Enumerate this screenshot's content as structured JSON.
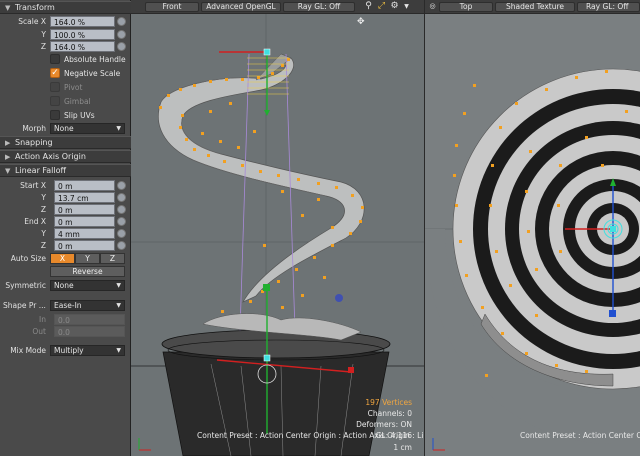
{
  "panel": {
    "transform": {
      "title": "Transform",
      "scale_label": "Scale X",
      "y_label": "Y",
      "z_label": "Z",
      "scale_x": "164.0 %",
      "scale_y": "100.0 %",
      "scale_z": "164.0 %",
      "absolute_handle": "Absolute Handle",
      "negative_scale": "Negative Scale",
      "pivot": "Pivot",
      "gimbal": "Gimbal",
      "slip_uvs": "Slip UVs",
      "morph_label": "Morph",
      "morph_value": "None"
    },
    "snapping": "Snapping",
    "action_axis_origin": "Action Axis Origin",
    "linear_falloff": {
      "title": "Linear Falloff",
      "start_label": "Start X",
      "start_x": "0 m",
      "start_y": "13.7 cm",
      "start_z": "0 m",
      "end_label": "End X",
      "end_x": "0 m",
      "end_y": "4 mm",
      "end_z": "0 m",
      "y_label": "Y",
      "z_label": "Z",
      "auto_size_label": "Auto Size",
      "auto_size_x": "X",
      "auto_size_y": "Y",
      "auto_size_z": "Z",
      "reverse": "Reverse",
      "symmetric_label": "Symmetric",
      "symmetric_value": "None",
      "shape_preset_label": "Shape Pr ...",
      "shape_preset_value": "Ease-In",
      "in_label": "In",
      "in_value": "0.0",
      "out_label": "Out",
      "out_value": "0.0",
      "mix_mode_label": "Mix Mode",
      "mix_mode_value": "Multiply"
    }
  },
  "viewport_left": {
    "view": "Front",
    "shading": "Advanced OpenGL",
    "raygl": "Ray GL: Off",
    "icons": [
      "search-icon",
      "fit-icon",
      "gear-icon",
      "dropdown-icon"
    ],
    "hud": {
      "vertices": "197 Vertices",
      "channels": "Channels: 0",
      "deformers": "Deformers: ON",
      "gl": "GL: 4,116",
      "unit": "1 cm",
      "status": "Content Preset : Action Center Origin : Action Axis Origin : Linea"
    }
  },
  "viewport_right": {
    "view": "Top",
    "shading": "Shaded Texture",
    "raygl": "Ray GL: Off",
    "status": "Content Preset : Action Center Origin : A"
  },
  "colors": {
    "accent": "#e8892b",
    "vertex": "#f2a020",
    "x_axis": "#d22020",
    "y_axis": "#20b030",
    "z_axis": "#2050d0",
    "handle": "#40e0e0"
  }
}
